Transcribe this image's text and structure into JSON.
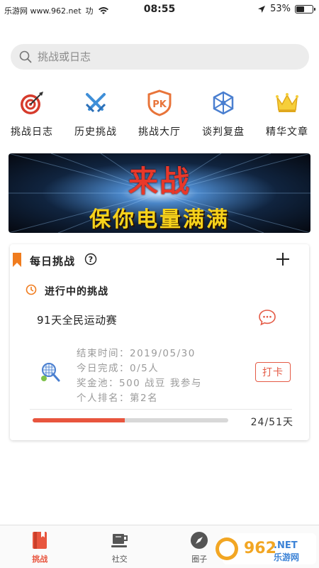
{
  "status_bar": {
    "carrier": "乐游网 www.962.net",
    "carrier_tail": "功",
    "time": "08:55",
    "battery": "53%",
    "battery_level": 0.53
  },
  "search": {
    "placeholder": "挑战或日志"
  },
  "quick_nav": [
    {
      "label": "挑战日志",
      "icon": "target-icon"
    },
    {
      "label": "历史挑战",
      "icon": "crossed-swords-icon"
    },
    {
      "label": "挑战大厅",
      "icon": "pk-shield-icon"
    },
    {
      "label": "谈判复盘",
      "icon": "network-icon"
    },
    {
      "label": "精华文章",
      "icon": "crown-icon"
    }
  ],
  "banner": {
    "title": "来战",
    "subtitle": "保你电量满满"
  },
  "daily": {
    "title": "每日挑战",
    "section_title": "进行中的挑战",
    "event_name": "91天全民运动赛",
    "end_time_label": "结束时间：",
    "end_time": "2019/05/30",
    "today_label": "今日完成：",
    "today": "0/5人",
    "pool_label": "奖金池：",
    "pool": "500 战豆 我参与",
    "rank_label": "个人排名：",
    "rank": "第2名",
    "checkin_label": "打卡",
    "progress_text": "24/51天",
    "progress": 0.47
  },
  "tabs": [
    {
      "label": "挑战",
      "active": true
    },
    {
      "label": "社交",
      "active": false
    },
    {
      "label": "圈子",
      "active": false
    }
  ],
  "watermark": {
    "text1": "962",
    "text2": ".NET",
    "text3": "乐游网"
  },
  "colors": {
    "accent": "#e8553e",
    "orange": "#f07c1e",
    "gold": "#f2c230",
    "blue": "#3b82d6"
  }
}
